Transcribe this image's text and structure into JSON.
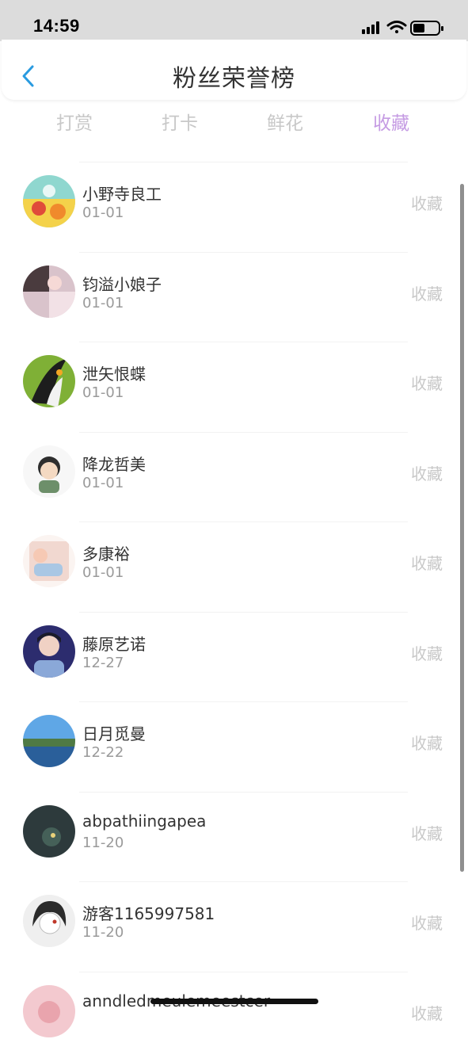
{
  "status_bar": {
    "time": "14:59"
  },
  "header": {
    "title": "粉丝荣誉榜"
  },
  "tabs": [
    {
      "label": "打赏"
    },
    {
      "label": "打卡"
    },
    {
      "label": "鲜花"
    },
    {
      "label": "收藏"
    }
  ],
  "colors": {
    "active_tab": "#c59be3",
    "inactive": "#c8c8c8",
    "back_icon": "#2a9be0"
  },
  "fans": [
    {
      "name": "小野寺良工",
      "date": "01-01",
      "type": "收藏"
    },
    {
      "name": "钧溢小娘子",
      "date": "01-01",
      "type": "收藏"
    },
    {
      "name": "泄矢恨蝶",
      "date": "01-01",
      "type": "收藏"
    },
    {
      "name": "降龙哲美",
      "date": "01-01",
      "type": "收藏"
    },
    {
      "name": "多康裕",
      "date": "01-01",
      "type": "收藏"
    },
    {
      "name": "藤原艺诺",
      "date": "12-27",
      "type": "收藏"
    },
    {
      "name": "日月觅曼",
      "date": "12-22",
      "type": "收藏"
    },
    {
      "name": "abpathiingapea",
      "date": "11-20",
      "type": "收藏"
    },
    {
      "name": "游客1165997581",
      "date": "11-20",
      "type": "收藏"
    },
    {
      "name": "anndledmeulemeestcer",
      "date": "",
      "type": "收藏"
    }
  ]
}
